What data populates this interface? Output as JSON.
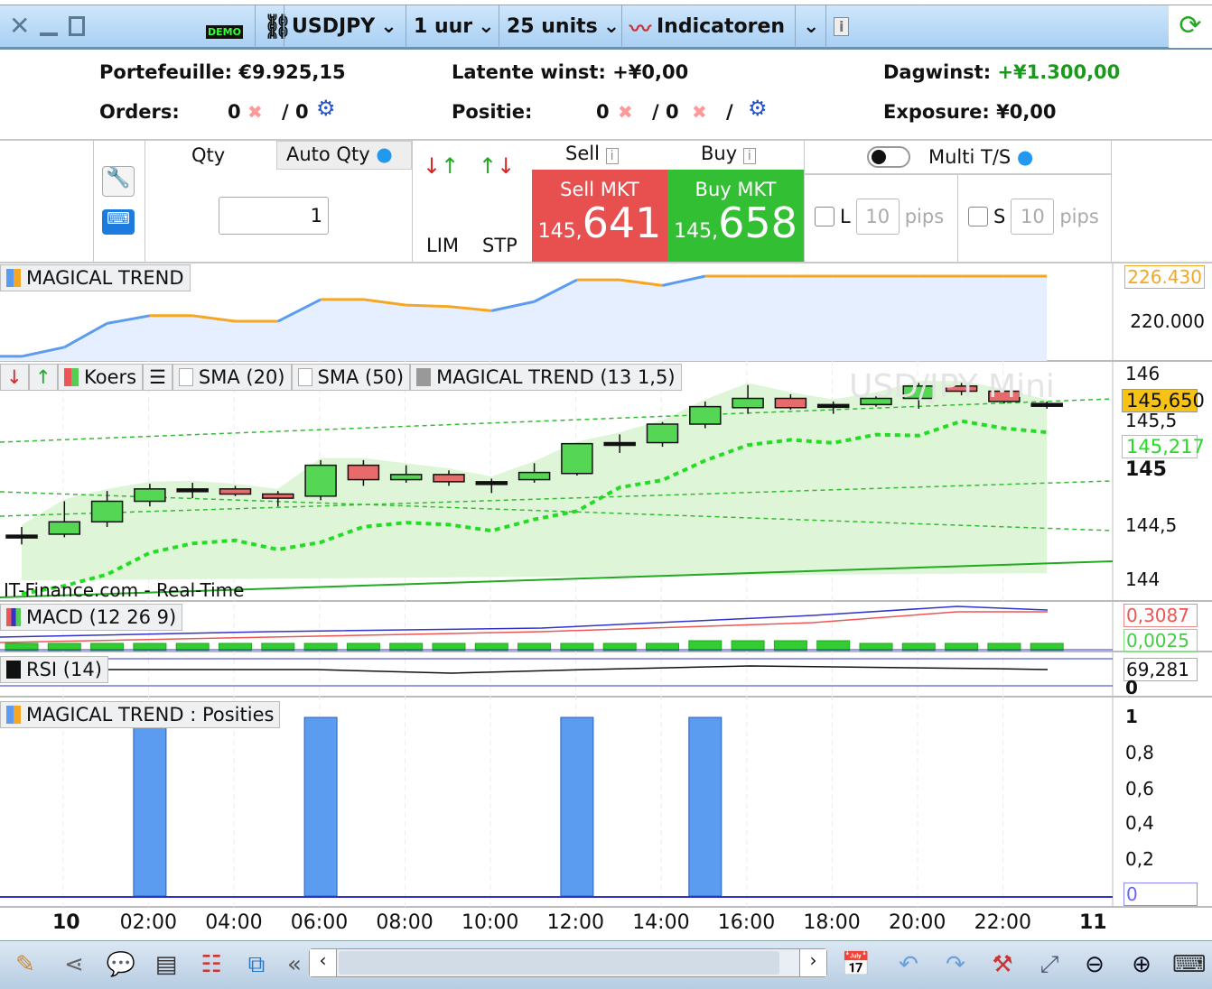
{
  "titlebar": {
    "close_icon": "close-icon",
    "minimize_icon": "minimize-icon",
    "maximize_icon": "maximize-icon",
    "demo_badge": "DEMO",
    "symbol": "USDJPY",
    "timeframe": "1 uur",
    "units": "25 units",
    "indicators": "Indicatoren"
  },
  "account": {
    "portfolio_label": "Portefeuille:",
    "portfolio_value": "€9.925,15",
    "latent_label": "Latente winst:",
    "latent_value": "+¥0,00",
    "dagwinst_label": "Dagwinst:",
    "dagwinst_value": "+¥1.300,00",
    "orders_label": "Orders:",
    "orders_a": "0",
    "orders_b": "/ 0",
    "positie_label": "Positie:",
    "positie_a": "0",
    "positie_b": "/ 0",
    "positie_c": "/",
    "exposure_label": "Exposure:",
    "exposure_value": "¥0,00"
  },
  "trade": {
    "qty_label": "Qty",
    "auto_qty_label": "Auto Qty",
    "qty_value": "1",
    "lim_label": "LIM",
    "stp_label": "STP",
    "sell_label": "Sell",
    "buy_label": "Buy",
    "sell_mkt_label": "Sell MKT",
    "buy_mkt_label": "Buy MKT",
    "sell_price_prefix": "145,",
    "sell_price_main": "641",
    "buy_price_prefix": "145,",
    "buy_price_main": "658",
    "multi_ts_label": "Multi T/S",
    "l_label": "L",
    "s_label": "S",
    "l_pips": "10",
    "s_pips": "10",
    "pips_label": "pips",
    "multi_ts_on": false
  },
  "colors": {
    "sell": "#e84f4f",
    "buy": "#33bf33",
    "up_candle": "#55d655",
    "down_candle": "#e86b6b",
    "trend_rising": "#5b9cf0",
    "trend_flat": "#f5a623"
  },
  "panels": {
    "magical_trend": {
      "legend": "MAGICAL TREND",
      "axis": [
        "226.430",
        "220.000"
      ]
    },
    "price": {
      "legend_koers": "Koers",
      "legend_sma20": "SMA (20)",
      "legend_sma50": "SMA (50)",
      "legend_mt": "MAGICAL TREND (13 1,5)",
      "watermark": "USD/JPY Mini",
      "source": "IT-Finance.com - Real-Time",
      "axis": [
        "146",
        "145,5",
        "145",
        "144,5",
        "144"
      ],
      "last_price": "145,650",
      "trend_price": "145,217"
    },
    "macd": {
      "legend": "MACD (12 26 9)",
      "value1": "0,3087",
      "value2": "0,0025"
    },
    "rsi": {
      "legend": "RSI (14)",
      "value": "69,281",
      "axis0": "0"
    },
    "positions": {
      "legend": "MAGICAL TREND : Posities",
      "axis": [
        "1",
        "0,8",
        "0,6",
        "0,4",
        "0,2",
        "0"
      ]
    }
  },
  "time_axis": [
    "10",
    "02:00",
    "04:00",
    "06:00",
    "08:00",
    "10:00",
    "12:00",
    "14:00",
    "16:00",
    "18:00",
    "20:00",
    "22:00",
    "11"
  ],
  "chart_data": [
    {
      "type": "candlestick",
      "name": "Koers",
      "hours": [
        "23:00",
        "00:00",
        "01:00",
        "02:00",
        "03:00",
        "04:00",
        "05:00",
        "06:00",
        "07:00",
        "08:00",
        "09:00",
        "10:00",
        "11:00",
        "12:00",
        "13:00",
        "14:00",
        "15:00",
        "16:00",
        "17:00",
        "18:00",
        "19:00",
        "20:00",
        "21:00",
        "22:00",
        "23:00"
      ],
      "ohlc": [
        [
          144.42,
          144.5,
          144.33,
          144.42
        ],
        [
          144.43,
          144.75,
          144.4,
          144.55
        ],
        [
          144.55,
          144.85,
          144.5,
          144.75
        ],
        [
          144.75,
          144.92,
          144.7,
          144.87
        ],
        [
          144.87,
          144.93,
          144.78,
          144.87
        ],
        [
          144.87,
          144.9,
          144.8,
          144.82
        ],
        [
          144.82,
          144.85,
          144.7,
          144.78
        ],
        [
          144.8,
          145.15,
          144.76,
          145.1
        ],
        [
          145.1,
          145.15,
          144.9,
          144.96
        ],
        [
          144.96,
          145.1,
          144.93,
          145.01
        ],
        [
          145.01,
          145.05,
          144.9,
          144.94
        ],
        [
          144.94,
          144.97,
          144.83,
          144.94
        ],
        [
          144.96,
          145.12,
          144.93,
          145.03
        ],
        [
          145.02,
          145.31,
          145.0,
          145.31
        ],
        [
          145.32,
          145.4,
          145.22,
          145.32
        ],
        [
          145.32,
          145.52,
          145.28,
          145.5
        ],
        [
          145.5,
          145.72,
          145.46,
          145.67
        ],
        [
          145.66,
          145.88,
          145.6,
          145.75
        ],
        [
          145.75,
          145.79,
          145.64,
          145.66
        ],
        [
          145.69,
          145.72,
          145.6,
          145.69
        ],
        [
          145.69,
          145.79,
          145.67,
          145.75
        ],
        [
          145.75,
          145.9,
          145.65,
          145.87
        ],
        [
          145.87,
          145.9,
          145.78,
          145.82
        ],
        [
          145.82,
          145.82,
          145.7,
          145.72
        ],
        [
          145.7,
          145.72,
          145.65,
          145.7
        ]
      ],
      "ylim": [
        143.9,
        146.05
      ]
    },
    {
      "type": "line",
      "name": "MAGICAL TREND",
      "values": [
        215.0,
        216.3,
        219.7,
        220.8,
        220.8,
        220.0,
        220.0,
        223.1,
        223.1,
        222.3,
        222.1,
        221.5,
        222.8,
        225.9,
        225.9,
        225.1,
        226.43,
        226.43,
        226.43,
        226.43,
        226.43,
        226.43,
        226.43,
        226.43,
        226.43
      ]
    },
    {
      "type": "bar",
      "name": "MAGICAL TREND : Posities",
      "categories": [
        "02:00",
        "06:00",
        "12:00",
        "15:00"
      ],
      "values": [
        1,
        1,
        1,
        1
      ],
      "ylim": [
        0,
        1
      ]
    }
  ],
  "bottom_toolbar": [
    "draw-icon",
    "share-icon",
    "comment-icon",
    "report-icon",
    "orderbook-icon",
    "windows-icon",
    "collapse-icon",
    "scroll-left-icon",
    "scroll-right-icon",
    "calendar-icon",
    "undo-icon",
    "redo-icon",
    "tools-icon",
    "zoom-fit-icon",
    "zoom-out-icon",
    "zoom-in-icon",
    "keyboard-icon"
  ]
}
